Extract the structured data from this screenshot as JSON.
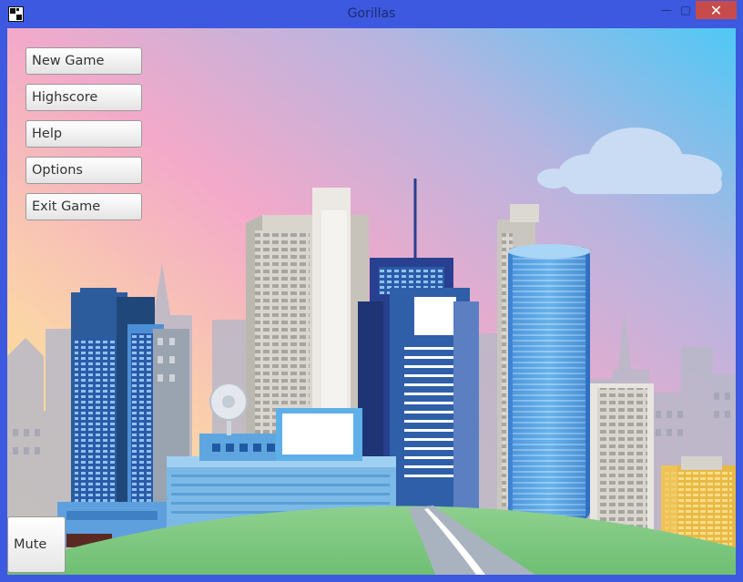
{
  "window": {
    "title": "Gorillas",
    "minimize_glyph": "—",
    "maximize_glyph": "□",
    "close_glyph": "✕",
    "accent": "#3c59df",
    "close_color": "#c74b4b"
  },
  "menu": {
    "new_game": "New Game",
    "highscore": "Highscore",
    "help": "Help",
    "options": "Options",
    "exit_game": "Exit Game"
  },
  "footer": {
    "mute": "Mute"
  },
  "scene": {
    "icons": [
      "city-skyline",
      "cloud",
      "satellite-dish",
      "hill",
      "road"
    ]
  }
}
